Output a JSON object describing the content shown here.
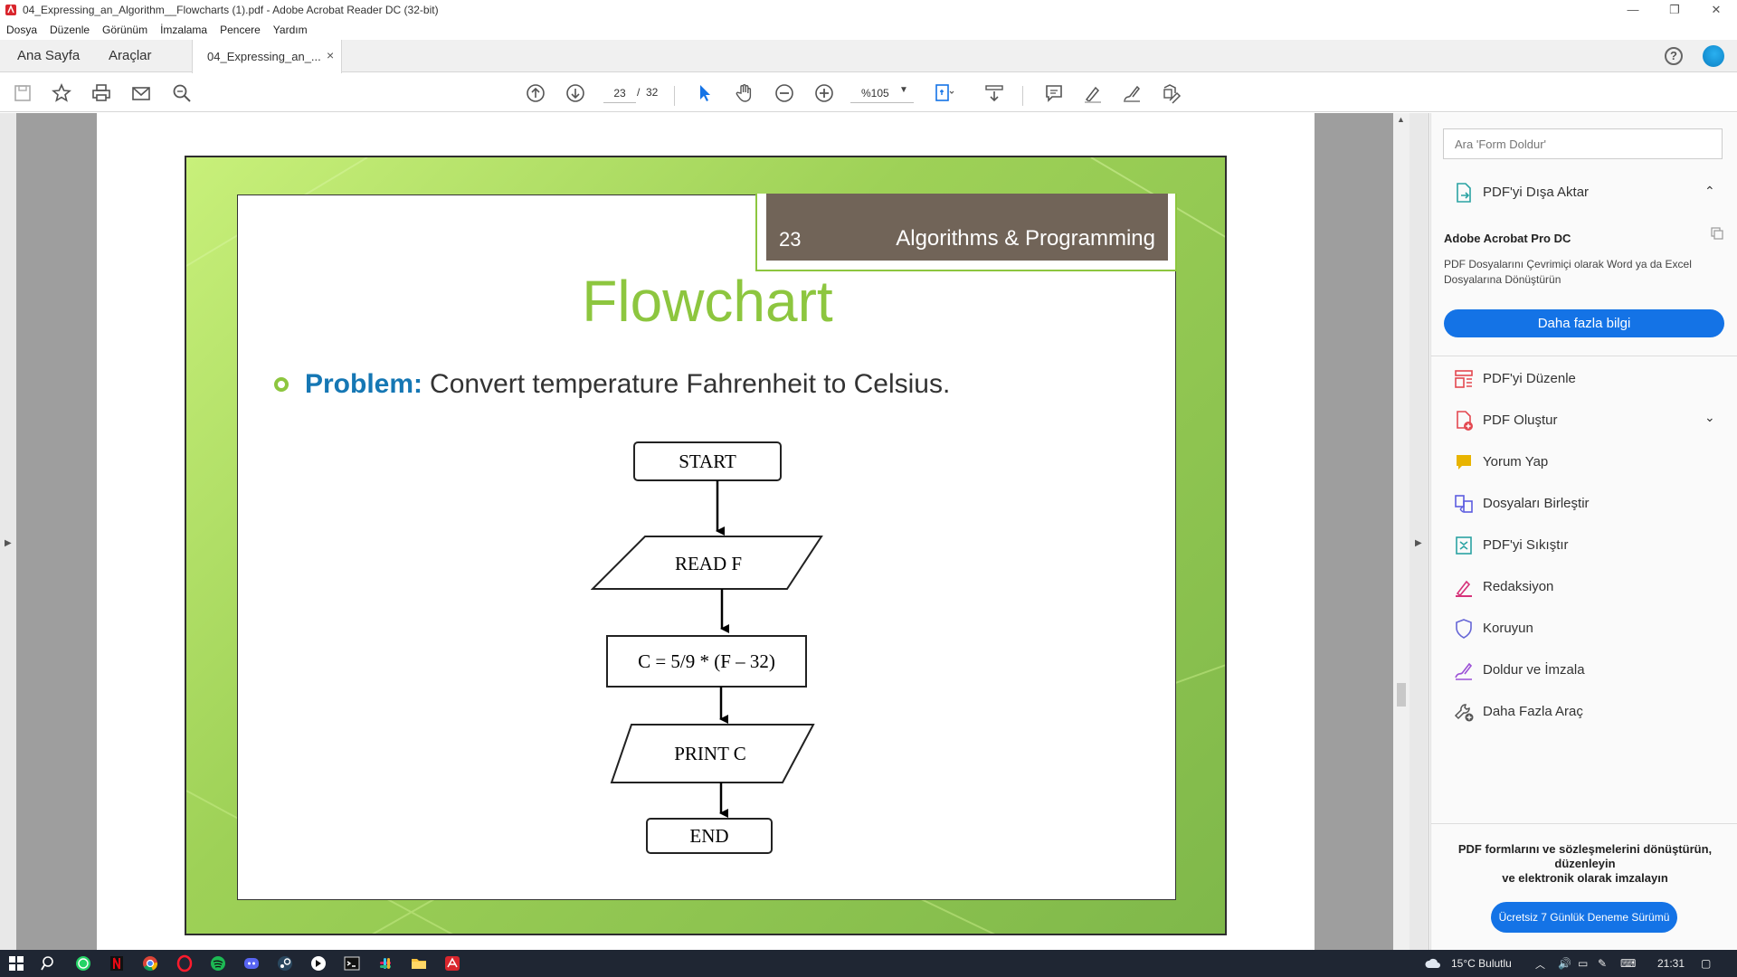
{
  "window": {
    "title": "04_Expressing_an_Algorithm__Flowcharts (1).pdf - Adobe Acrobat Reader DC (32-bit)",
    "minimize": "—",
    "restore": "❐",
    "close": "✕"
  },
  "menu": [
    "Dosya",
    "Düzenle",
    "Görünüm",
    "İmzalama",
    "Pencere",
    "Yardım"
  ],
  "tabs": {
    "home": "Ana Sayfa",
    "tools": "Araçlar",
    "document": "04_Expressing_an_...",
    "close": "×"
  },
  "toolbar": {
    "page_current": "23",
    "page_separator": "/",
    "page_total": "32",
    "zoom": "%105"
  },
  "slide": {
    "number": "23",
    "course": "Algorithms & Programming",
    "title": "Flowchart",
    "problem_label": "Problem:",
    "problem_text": "Convert temperature Fahrenheit to Celsius.",
    "flow": [
      "START",
      "READ F",
      "C = 5/9 * (F – 32)",
      "PRINT C",
      "END"
    ]
  },
  "right_panel": {
    "search_placeholder": "Ara 'Form Doldur'",
    "export": "PDF'yi Dışa Aktar",
    "promo_title": "Adobe Acrobat Pro DC",
    "promo_text": "PDF Dosyalarını Çevrimiçi olarak Word ya da Excel Dosyalarına Dönüştürün",
    "promo_button": "Daha fazla bilgi",
    "tools": [
      {
        "label": "PDF'yi Düzenle",
        "color": "#e34850"
      },
      {
        "label": "PDF Oluştur",
        "color": "#e34850"
      },
      {
        "label": "Yorum Yap",
        "color": "#e8b400"
      },
      {
        "label": "Dosyaları Birleştir",
        "color": "#5c5ce0"
      },
      {
        "label": "PDF'yi Sıkıştır",
        "color": "#2ba3a3"
      },
      {
        "label": "Redaksiyon",
        "color": "#d6337a"
      },
      {
        "label": "Koruyun",
        "color": "#6666d6"
      },
      {
        "label": "Doldur ve İmzala",
        "color": "#9b4fd6"
      },
      {
        "label": "Daha Fazla Araç",
        "color": "#555555"
      }
    ],
    "bottom_text_1": "PDF formlarını ve sözleşmelerini dönüştürün, düzenleyin",
    "bottom_text_2": "ve elektronik olarak imzalayın",
    "trial_button": "Ücretsiz 7 Günlük Deneme Sürümü"
  },
  "taskbar": {
    "weather": "15°C  Bulutlu",
    "time": "21:31"
  }
}
